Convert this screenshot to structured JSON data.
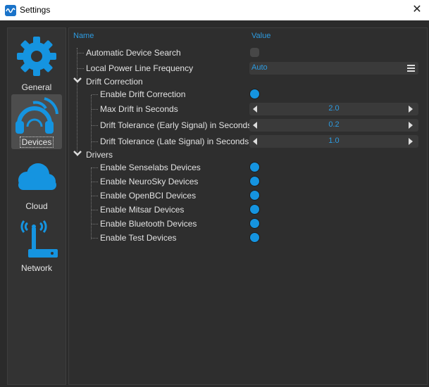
{
  "window": {
    "title": "Settings",
    "close_glyph": "✕"
  },
  "sidebar": {
    "items": [
      {
        "label": "General",
        "icon": "gear-icon",
        "selected": false
      },
      {
        "label": "Devices",
        "icon": "headset-icon",
        "selected": true
      },
      {
        "label": "Cloud",
        "icon": "cloud-icon",
        "selected": false
      },
      {
        "label": "Network",
        "icon": "antenna-icon",
        "selected": false
      }
    ]
  },
  "table": {
    "headers": {
      "name": "Name",
      "value": "Value"
    },
    "rows": {
      "auto_search": {
        "label": "Automatic Device Search",
        "value": false
      },
      "power_line": {
        "label": "Local Power Line Frequency",
        "value": "Auto"
      },
      "drift_group": {
        "label": "Drift Correction"
      },
      "enable_drift": {
        "label": "Enable Drift Correction",
        "value": true
      },
      "max_drift": {
        "label": "Max Drift in Seconds",
        "value": "2.0"
      },
      "tol_early": {
        "label": "Drift Tolerance (Early Signal) in Seconds",
        "value": "0.2"
      },
      "tol_late": {
        "label": "Drift Tolerance (Late Signal) in Seconds",
        "value": "1.0"
      },
      "drivers_group": {
        "label": "Drivers"
      },
      "senselabs": {
        "label": "Enable Senselabs Devices",
        "value": true
      },
      "neurosky": {
        "label": "Enable NeuroSky Devices",
        "value": true
      },
      "openbci": {
        "label": "Enable OpenBCI Devices",
        "value": true
      },
      "mitsar": {
        "label": "Enable Mitsar Devices",
        "value": true
      },
      "bluetooth": {
        "label": "Enable Bluetooth Devices",
        "value": true
      },
      "test": {
        "label": "Enable Test Devices",
        "value": true
      }
    }
  },
  "colors": {
    "accent": "#1594e0",
    "background": "#2b2b2b",
    "panel": "#2e2e2e",
    "text": "#e2e2e2"
  }
}
